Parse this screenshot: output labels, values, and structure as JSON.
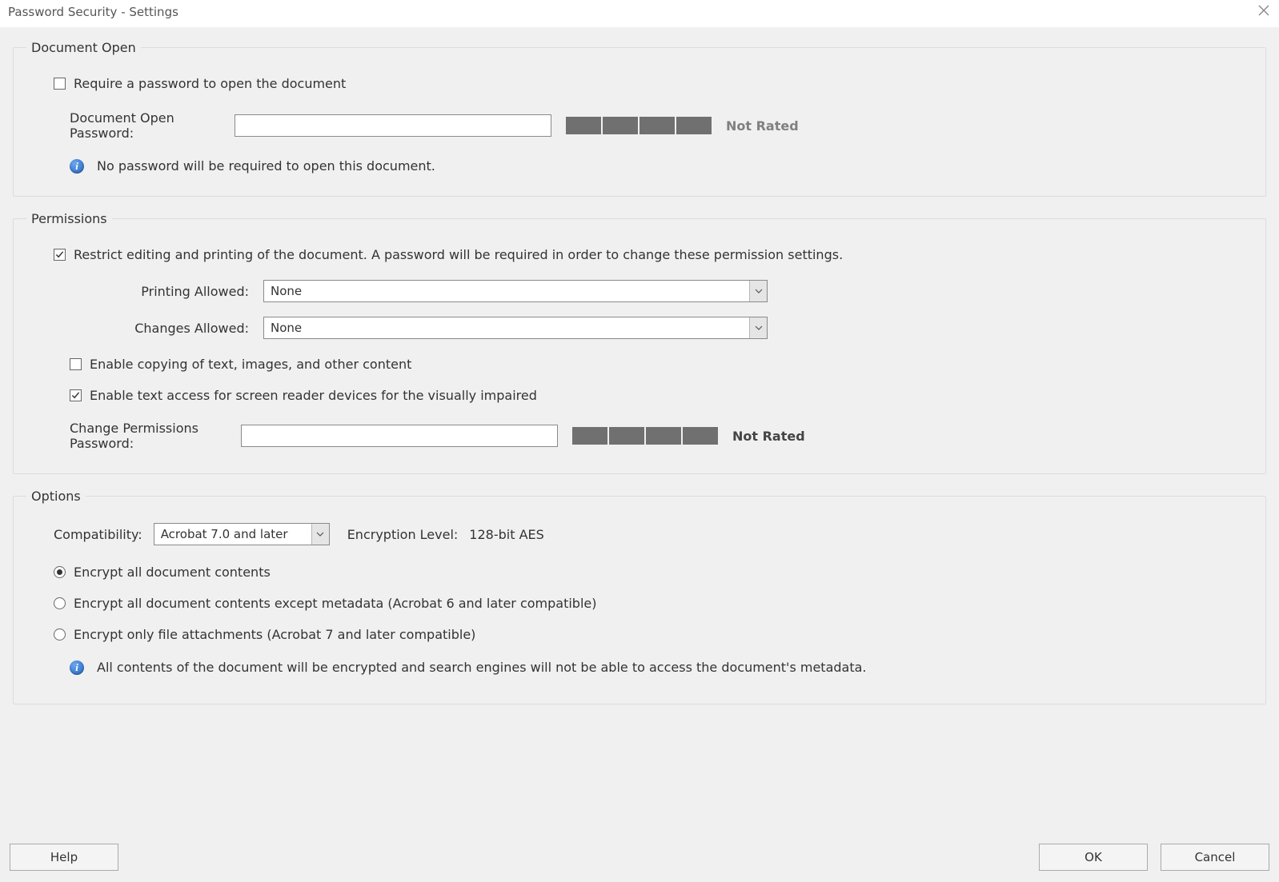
{
  "window": {
    "title": "Password Security - Settings"
  },
  "documentOpen": {
    "legend": "Document Open",
    "require_checkbox_label": "Require a password to open the document",
    "require_checked": false,
    "password_label": "Document Open Password:",
    "password_value": "",
    "strength_text": "Not Rated",
    "info_text": "No password will be required to open this document."
  },
  "permissions": {
    "legend": "Permissions",
    "restrict_label": "Restrict editing and printing of the document. A password will be required in order to change these permission settings.",
    "restrict_checked": true,
    "printing_label": "Printing Allowed:",
    "printing_value": "None",
    "changes_label": "Changes Allowed:",
    "changes_value": "None",
    "enable_copy_label": "Enable copying of text, images, and other content",
    "enable_copy_checked": false,
    "enable_screenreader_label": "Enable text access for screen reader devices for the visually impaired",
    "enable_screenreader_checked": true,
    "change_pw_label": "Change Permissions Password:",
    "change_pw_value": "",
    "strength_text": "Not Rated"
  },
  "options": {
    "legend": "Options",
    "compat_label": "Compatibility:",
    "compat_value": "Acrobat 7.0 and later",
    "enc_level_label": "Encryption  Level:",
    "enc_level_value": "128-bit AES",
    "radio": {
      "r1": "Encrypt all document contents",
      "r2": "Encrypt all document contents except metadata (Acrobat 6 and later compatible)",
      "r3": "Encrypt only file attachments (Acrobat 7 and later compatible)",
      "selected": "r1"
    },
    "info_text": "All contents of the document will be encrypted and search engines will not be able to access the document's metadata."
  },
  "buttons": {
    "help": "Help",
    "ok": "OK",
    "cancel": "Cancel"
  }
}
